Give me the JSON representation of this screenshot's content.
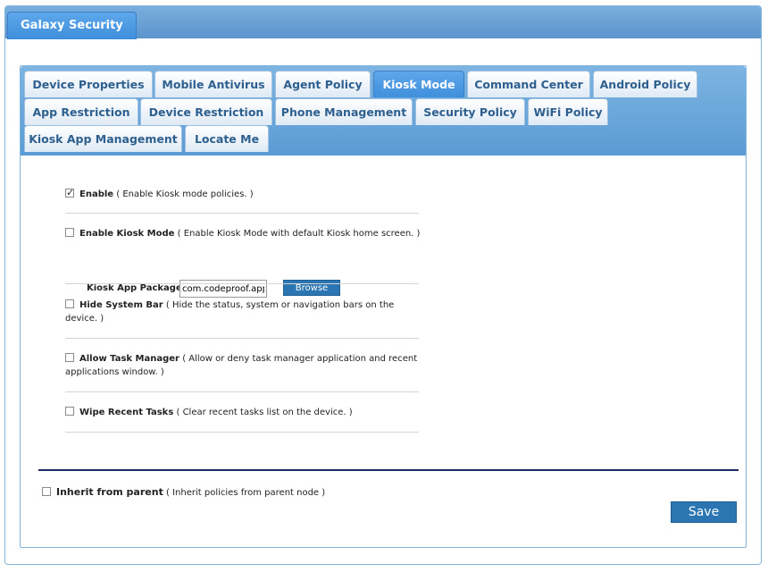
{
  "header": {
    "title": "Galaxy Security"
  },
  "tabs": [
    {
      "label": "Device Properties"
    },
    {
      "label": "Mobile Antivirus"
    },
    {
      "label": "Agent Policy"
    },
    {
      "label": "Kiosk Mode"
    },
    {
      "label": "Command Center"
    },
    {
      "label": "Android Policy"
    },
    {
      "label": "App Restriction"
    },
    {
      "label": "Device Restriction"
    },
    {
      "label": "Phone Management"
    },
    {
      "label": "Security Policy"
    },
    {
      "label": "WiFi Policy"
    },
    {
      "label": "Kiosk App Management"
    },
    {
      "label": "Locate Me"
    }
  ],
  "active_tab": "Kiosk Mode",
  "options": {
    "enable": {
      "label": "Enable",
      "desc": "( Enable Kiosk mode policies. )",
      "checked": true
    },
    "enable_kiosk_mode": {
      "label": "Enable Kiosk Mode",
      "desc": "( Enable Kiosk Mode with default Kiosk home screen. )",
      "checked": false
    },
    "hide_system_bar": {
      "label": "Hide System Bar",
      "desc": "( Hide the status, system or navigation bars on the device. )",
      "checked": false
    },
    "allow_task_manager": {
      "label": "Allow Task Manager",
      "desc": "( Allow or deny task manager application and recent applications window. )",
      "checked": false
    },
    "wipe_recent_tasks": {
      "label": "Wipe Recent Tasks",
      "desc": "( Clear recent tasks list on the device. )",
      "checked": false
    }
  },
  "kiosk_package": {
    "label": "Kiosk App Package",
    "value": "com.codeproof.appr",
    "browse_label": "Browse"
  },
  "inherit": {
    "label": "Inherit from parent",
    "desc": "( Inherit policies from parent node )",
    "checked": false
  },
  "save_label": "Save"
}
